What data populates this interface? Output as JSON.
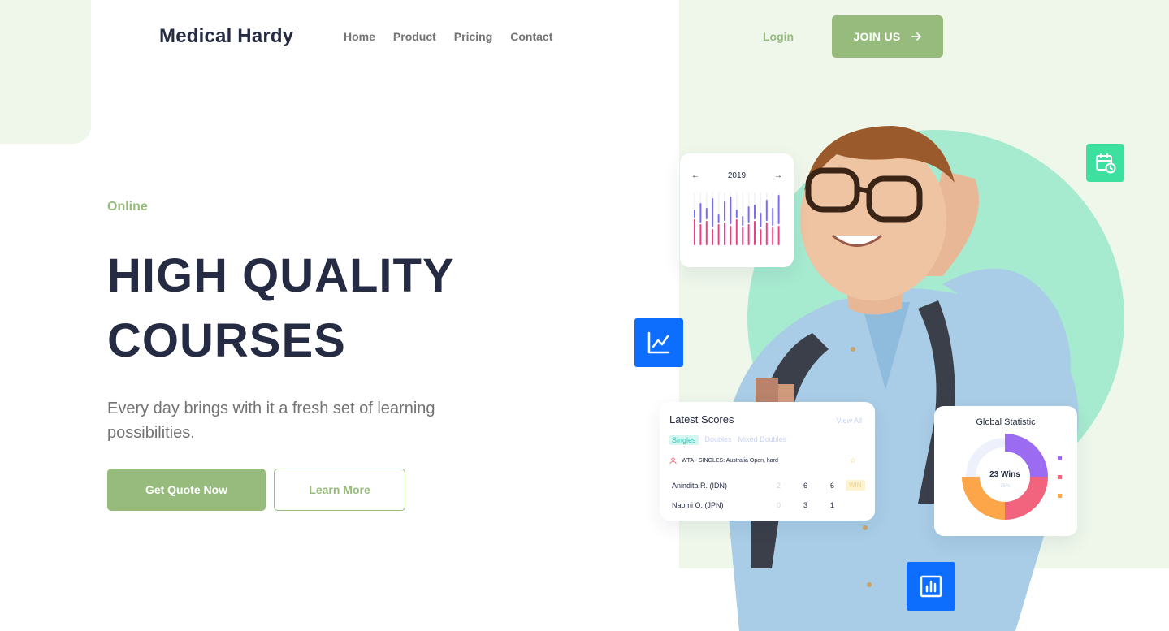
{
  "header": {
    "logo": "Medical Hardy",
    "nav": [
      "Home",
      "Product",
      "Pricing",
      "Contact"
    ],
    "login_label": "Login",
    "join_label": "JOIN US"
  },
  "hero": {
    "eyebrow": "Online",
    "title_line1": "HIGH QUALITY",
    "title_line2": "COURSES",
    "subtitle": "Every day brings with it a fresh set of learning possibilities.",
    "primary_button": "Get Quote Now",
    "secondary_button": "Learn More"
  },
  "year_card": {
    "year": "2019",
    "prev_arrow": "←",
    "next_arrow": "→"
  },
  "scores_card": {
    "title": "Latest Scores",
    "view_all": "View All",
    "tabs": [
      "Singles",
      "Doubles",
      "Mixed Doubles"
    ],
    "active_tab": "Singles",
    "match": "WTA - SINGLES: Australia Open, hard",
    "rows": [
      {
        "name": "Anindita R. (IDN)",
        "s1": "2",
        "s2": "6",
        "s3": "6",
        "badge": "WIN"
      },
      {
        "name": "Naomi O. (JPN)",
        "s1": "0",
        "s2": "3",
        "s3": "1",
        "badge": ""
      }
    ]
  },
  "stat_card": {
    "title": "Global Statistic",
    "center_label": "23 Wins",
    "center_sub": "75%",
    "segments": [
      {
        "color": "#9b6cf2",
        "share": 0.25
      },
      {
        "color": "#f2637e",
        "share": 0.25
      },
      {
        "color": "#fca549",
        "share": 0.25
      },
      {
        "color": "#eef0fb",
        "share": 0.25
      }
    ]
  },
  "colors": {
    "accent": "#96bb7c",
    "dark": "#252b42",
    "muted": "#737373",
    "light_green_bg": "#eef7ea",
    "mint_circle": "#a6ead0",
    "blue_tile": "#0d6efd",
    "green_tile": "#3ee0a0"
  },
  "icons": [
    "arrow-right-icon",
    "calendar-clock-icon",
    "line-chart-icon",
    "bar-chart-icon",
    "user-icon",
    "star-icon"
  ]
}
